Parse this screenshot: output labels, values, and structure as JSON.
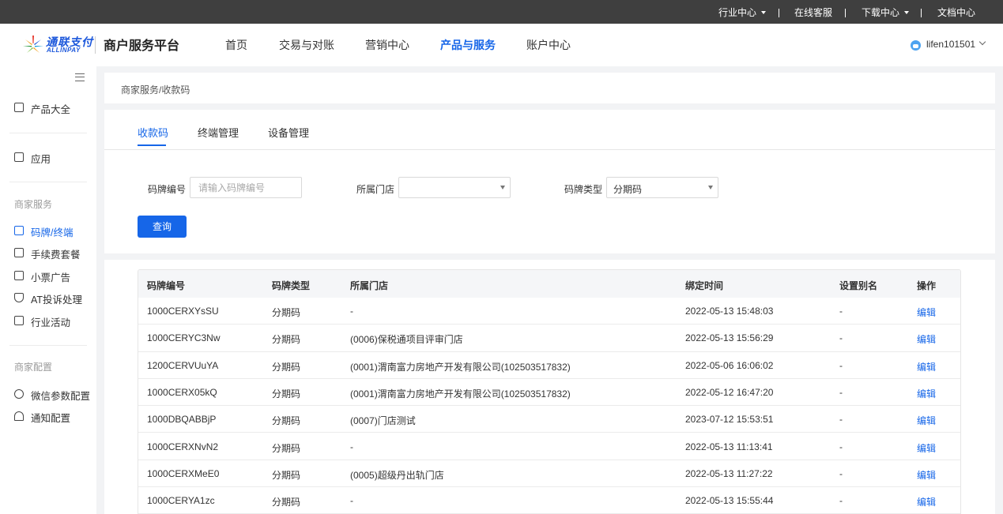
{
  "topbar": {
    "industry_center": "行业中心",
    "online_service": "在线客服",
    "download_center": "下载中心",
    "docs_center": "文档中心"
  },
  "header": {
    "logo_cn": "通联支付",
    "logo_en": "ALLINPAY",
    "platform_title": "商户服务平台",
    "nav": [
      "首页",
      "交易与对账",
      "营销中心",
      "产品与服务",
      "账户中心"
    ],
    "active_nav": "产品与服务",
    "username": "lifen101501"
  },
  "sidebar": {
    "product_catalog": "产品大全",
    "apps": "应用",
    "group_merchant_service": "商家服务",
    "code_terminal": "码牌/终端",
    "fee_package": "手续费套餐",
    "receipt_ads": "小票广告",
    "at_complaint": "AT投诉处理",
    "industry_activity": "行业活动",
    "group_merchant_config": "商家配置",
    "wechat_params": "微信参数配置",
    "notification_config": "通知配置"
  },
  "breadcrumb": "商家服务/收款码",
  "tabs": [
    "收款码",
    "终端管理",
    "设备管理"
  ],
  "filters": {
    "code_no_label": "码牌编号",
    "code_no_placeholder": "请输入码牌编号",
    "code_no_value": "",
    "store_label": "所属门店",
    "store_value": "",
    "code_type_label": "码牌类型",
    "code_type_value": "分期码",
    "query_button": "查询"
  },
  "table": {
    "columns": [
      "码牌编号",
      "码牌类型",
      "所属门店",
      "绑定时间",
      "设置别名",
      "操作"
    ],
    "rows": [
      {
        "code": "1000CERXYsSU",
        "type": "分期码",
        "store": "-",
        "bind_time": "2022-05-13 15:48:03",
        "alias": "-",
        "action": "编辑"
      },
      {
        "code": "1000CERYC3Nw",
        "type": "分期码",
        "store": "(0006)保税通项目评审门店",
        "bind_time": "2022-05-13 15:56:29",
        "alias": "-",
        "action": "编辑"
      },
      {
        "code": "1200CERVUuYA",
        "type": "分期码",
        "store": "(0001)渭南富力房地产开发有限公司(102503517832)",
        "bind_time": "2022-05-06 16:06:02",
        "alias": "-",
        "action": "编辑"
      },
      {
        "code": "1000CERX05kQ",
        "type": "分期码",
        "store": "(0001)渭南富力房地产开发有限公司(102503517832)",
        "bind_time": "2022-05-12 16:47:20",
        "alias": "-",
        "action": "编辑"
      },
      {
        "code": "1000DBQABBjP",
        "type": "分期码",
        "store": "(0007)门店测试",
        "bind_time": "2023-07-12 15:53:51",
        "alias": "-",
        "action": "编辑"
      },
      {
        "code": "1000CERXNvN2",
        "type": "分期码",
        "store": "-",
        "bind_time": "2022-05-13 11:13:41",
        "alias": "-",
        "action": "编辑"
      },
      {
        "code": "1000CERXMeE0",
        "type": "分期码",
        "store": "(0005)超级丹出轨门店",
        "bind_time": "2022-05-13 11:27:22",
        "alias": "-",
        "action": "编辑"
      },
      {
        "code": "1000CERYA1zc",
        "type": "分期码",
        "store": "-",
        "bind_time": "2022-05-13 15:55:44",
        "alias": "-",
        "action": "编辑"
      }
    ]
  },
  "colors": {
    "accent": "#1666e8",
    "topbar_bg": "#3f3f3f",
    "page_bg": "#f2f3f5"
  },
  "icons": {
    "product_catalog": "cube-icon",
    "apps": "archive-box-icon",
    "code_terminal": "terminal-icon",
    "fee_package": "package-icon",
    "receipt_ads": "receipt-icon",
    "at_complaint": "shield-icon",
    "industry_activity": "cart-icon",
    "wechat_params": "settings-cube-icon",
    "notification_config": "bell-icon"
  }
}
